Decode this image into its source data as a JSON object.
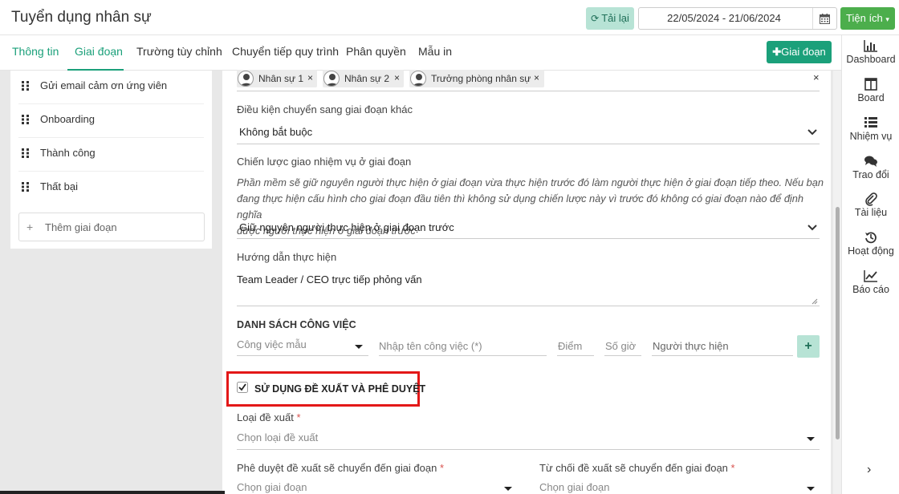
{
  "app": {
    "title": "Tuyển dụng nhân sự"
  },
  "toolbar": {
    "reload_label": "Tải lại",
    "date_range": "22/05/2024 - 21/06/2024",
    "utilities_label": "Tiện ích"
  },
  "tabs": [
    {
      "label": "Thông tin"
    },
    {
      "label": "Giai đoạn"
    },
    {
      "label": "Trường tùy chỉnh"
    },
    {
      "label": "Chuyển tiếp quy trình"
    },
    {
      "label": "Phân quyền"
    },
    {
      "label": "Mẫu in"
    }
  ],
  "add_stage_button": "Giai đoạn",
  "stages": [
    {
      "label": "Gửi email cảm ơn ứng viên"
    },
    {
      "label": "Onboarding"
    },
    {
      "label": "Thành công"
    },
    {
      "label": "Thất bại"
    }
  ],
  "add_stage_placeholder": "Thêm giai đoạn",
  "form": {
    "assignees": [
      "Nhân sự 1",
      "Nhân sự 2",
      "Trưởng phòng nhân sự"
    ],
    "transition_condition": {
      "label": "Điều kiện chuyển sang giai đoạn khác",
      "value": "Không bắt buộc"
    },
    "assignment_strategy": {
      "label": "Chiến lược giao nhiệm vụ ở giai đoạn",
      "description_lines": [
        "Phần mềm sẽ giữ nguyên người thực hiện ở giai đoạn vừa thực hiện trước đó làm người thực hiện ở giai đoạn tiếp theo. Nếu bạn",
        "đang thực hiện cấu hình cho giai đoạn đầu tiên thì không sử dụng chiến lược này vì trước đó không có giai đoạn nào để định nghĩa",
        "được người thực hiện ở giai đoạn trước"
      ],
      "value": "Giữ nguyên người thực hiện ở giai đoạn trước"
    },
    "instructions": {
      "label": "Hướng dẫn thực hiện",
      "value": "Team Leader / CEO trực tiếp phỏng vấn"
    },
    "task_list": {
      "title": "DANH SÁCH CÔNG VIỆC",
      "template_placeholder": "Công việc mẫu",
      "name_placeholder": "Nhập tên công việc (*)",
      "score_placeholder": "Điểm",
      "hours_placeholder": "Số giờ",
      "assignee_placeholder": "Người thực hiện"
    },
    "approval": {
      "checkbox_label": "SỬ DỤNG ĐỀ XUẤT VÀ PHÊ DUYỆT",
      "checked": true,
      "proposal_type_label": "Loại đề xuất",
      "proposal_type_placeholder": "Chọn loại đề xuất",
      "approve_stage_label": "Phê duyệt đề xuất sẽ chuyển đến giai đoạn",
      "approve_stage_placeholder": "Chọn giai đoạn",
      "reject_stage_label": "Từ chối đề xuất sẽ chuyển đến giai đoạn",
      "reject_stage_placeholder": "Chọn giai đoạn",
      "required_mark": "*"
    }
  },
  "right_sidebar": [
    {
      "label": "Dashboard",
      "icon": "bar-chart-icon"
    },
    {
      "label": "Board",
      "icon": "board-icon"
    },
    {
      "label": "Nhiệm vụ",
      "icon": "list-icon"
    },
    {
      "label": "Trao đổi",
      "icon": "comments-icon"
    },
    {
      "label": "Tài liệu",
      "icon": "paperclip-icon"
    },
    {
      "label": "Hoạt động",
      "icon": "history-icon"
    },
    {
      "label": "Báo cáo",
      "icon": "line-chart-icon"
    }
  ],
  "colors": {
    "primary": "#1ba07a",
    "success": "#4cae4c",
    "highlight": "#e31818",
    "reload_bg": "#b7e3d5"
  }
}
